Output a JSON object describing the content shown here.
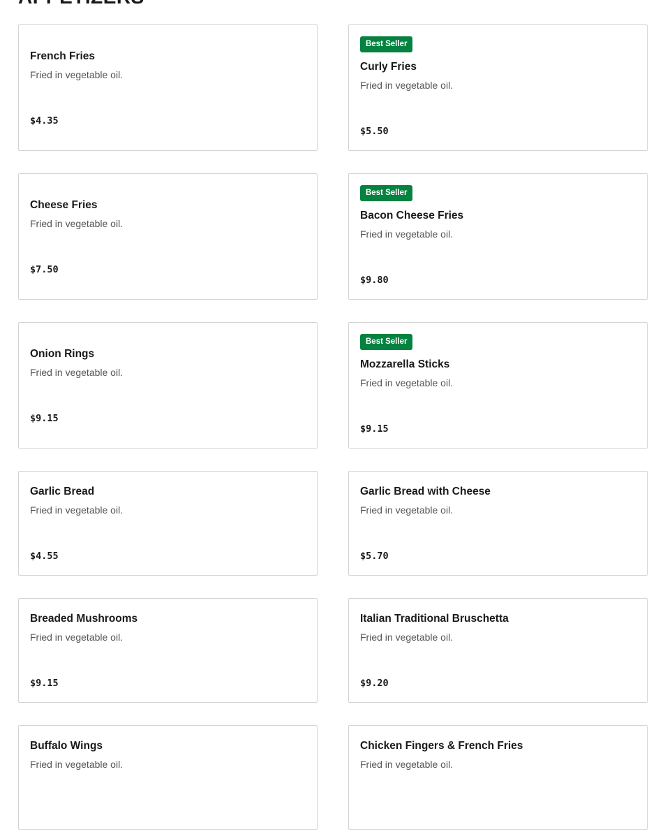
{
  "section": {
    "title": "APPETIZERS"
  },
  "badge_color": "#05823f",
  "items": [
    {
      "name": "French Fries",
      "description": "Fried in vegetable oil.",
      "price": "$4.35",
      "badge": ""
    },
    {
      "name": "Curly Fries",
      "description": "Fried in vegetable oil.",
      "price": "$5.50",
      "badge": "Best Seller"
    },
    {
      "name": "Cheese Fries",
      "description": "Fried in vegetable oil.",
      "price": "$7.50",
      "badge": ""
    },
    {
      "name": "Bacon Cheese Fries",
      "description": "Fried in vegetable oil.",
      "price": "$9.80",
      "badge": "Best Seller"
    },
    {
      "name": "Onion Rings",
      "description": "Fried in vegetable oil.",
      "price": "$9.15",
      "badge": ""
    },
    {
      "name": "Mozzarella Sticks",
      "description": "Fried in vegetable oil.",
      "price": "$9.15",
      "badge": "Best Seller"
    },
    {
      "name": "Garlic Bread",
      "description": "Fried in vegetable oil.",
      "price": "$4.55",
      "badge": ""
    },
    {
      "name": "Garlic Bread with Cheese",
      "description": "Fried in vegetable oil.",
      "price": "$5.70",
      "badge": ""
    },
    {
      "name": "Breaded Mushrooms",
      "description": "Fried in vegetable oil.",
      "price": "$9.15",
      "badge": ""
    },
    {
      "name": "Italian Traditional Bruschetta",
      "description": "Fried in vegetable oil.",
      "price": "$9.20",
      "badge": ""
    },
    {
      "name": "Buffalo Wings",
      "description": "Fried in vegetable oil.",
      "price": "",
      "badge": ""
    },
    {
      "name": "Chicken Fingers & French Fries",
      "description": "Fried in vegetable oil.",
      "price": "",
      "badge": ""
    }
  ]
}
